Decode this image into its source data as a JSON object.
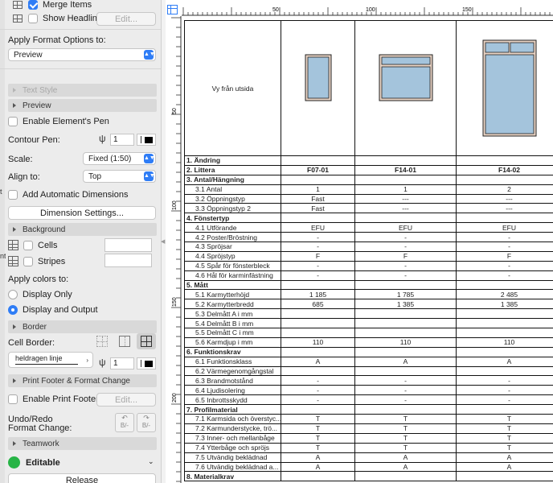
{
  "panel": {
    "merge_items": "Merge Items",
    "show_headline": "Show Headline",
    "edit_label": "Edit...",
    "apply_format_options_to": "Apply Format Options to:",
    "apply_target": "Preview",
    "sections": {
      "text_style": "Text Style",
      "preview": "Preview",
      "background": "Background",
      "border": "Border",
      "print_footer": "Print Footer & Format Change",
      "teamwork": "Teamwork"
    },
    "enable_elements_pen": "Enable Element's Pen",
    "contour_pen_label": "Contour Pen:",
    "contour_pen_value": "1",
    "scale_label": "Scale:",
    "scale_value": "Fixed (1:50)",
    "align_label": "Align to:",
    "align_value": "Top",
    "add_automatic_dimensions": "Add Automatic Dimensions",
    "dimension_settings": "Dimension Settings...",
    "cells_label": "Cells",
    "stripes_label": "Stripes",
    "apply_colors_to": "Apply colors to:",
    "display_only": "Display Only",
    "display_and_output": "Display and Output",
    "cell_border_label": "Cell Border:",
    "line_type": "heldragen linje",
    "border_pen_value": "1",
    "enable_print_footer": "Enable Print Footer",
    "edit_label_2": "Edit...",
    "undo_redo_label": "Undo/Redo",
    "format_change_label": "Format Change:",
    "undo_icon_text": "B/-",
    "redo_icon_text": "B/-",
    "editable_label": "Editable",
    "release_label": "Release",
    "edge_tab_1": "t",
    "edge_tab_2": "nt",
    "colors": {
      "accent": "#2f7df6",
      "editable_dot": "#27b446"
    }
  },
  "ruler": {
    "h_marks": [
      "50",
      "100",
      "150"
    ],
    "v_marks": [
      "50",
      "100",
      "150",
      "200"
    ]
  },
  "table": {
    "header_caption": "Vy från utsida",
    "columns": [
      "F07-01",
      "F14-01",
      "F14-02"
    ],
    "rows": [
      {
        "label": "1. Ändring",
        "section": true,
        "values": [
          "",
          "",
          ""
        ]
      },
      {
        "label": "2. Littera",
        "section": true,
        "values": [
          "F07-01",
          "F14-01",
          "F14-02"
        ]
      },
      {
        "label": "3. Antal/Hängning",
        "section": true,
        "values": [
          "",
          "",
          ""
        ]
      },
      {
        "label": "3.1 Antal",
        "section": false,
        "values": [
          "1",
          "1",
          "2"
        ]
      },
      {
        "label": "3.2 Öppningstyp",
        "section": false,
        "values": [
          "Fast",
          "---",
          "---"
        ]
      },
      {
        "label": "3.3 Öppningstyp 2",
        "section": false,
        "values": [
          "Fast",
          "---",
          "---"
        ]
      },
      {
        "label": "4. Fönstertyp",
        "section": true,
        "values": [
          "",
          "",
          ""
        ]
      },
      {
        "label": "4.1 Utförande",
        "section": false,
        "values": [
          "EFU",
          "EFU",
          "EFU"
        ]
      },
      {
        "label": "4.2 Poster/Bröstning",
        "section": false,
        "values": [
          "-",
          "-",
          "-"
        ]
      },
      {
        "label": "4.3 Spröjsar",
        "section": false,
        "values": [
          "-",
          "-",
          "-"
        ]
      },
      {
        "label": "4.4 Spröjstyp",
        "section": false,
        "values": [
          "F",
          "F",
          "F"
        ]
      },
      {
        "label": "4.5 Spår för fönsterbleck",
        "section": false,
        "values": [
          "-",
          "-",
          "-"
        ]
      },
      {
        "label": "4.6 Hål för karminfästning",
        "section": false,
        "values": [
          "-",
          "-",
          "-"
        ]
      },
      {
        "label": "5. Mått",
        "section": true,
        "values": [
          "",
          "",
          ""
        ]
      },
      {
        "label": "5.1 Karmytterhöjd",
        "section": false,
        "values": [
          "1 185",
          "1 785",
          "2 485"
        ]
      },
      {
        "label": "5.2 Karmytterbredd",
        "section": false,
        "values": [
          "685",
          "1 385",
          "1 385"
        ]
      },
      {
        "label": "5.3 Delmått A i mm",
        "section": false,
        "values": [
          "",
          "",
          ""
        ]
      },
      {
        "label": "5.4 Delmått B i mm",
        "section": false,
        "values": [
          "",
          "",
          ""
        ]
      },
      {
        "label": "5.5 Delmått C i mm",
        "section": false,
        "values": [
          "",
          "",
          ""
        ]
      },
      {
        "label": "5.6 Karmdjup i mm",
        "section": false,
        "values": [
          "110",
          "110",
          "110"
        ]
      },
      {
        "label": "6. Funktionskrav",
        "section": true,
        "values": [
          "",
          "",
          ""
        ]
      },
      {
        "label": "6.1 Funktionsklass",
        "section": false,
        "values": [
          "A",
          "A",
          "A"
        ]
      },
      {
        "label": "6.2 Värmegenomgångstal",
        "section": false,
        "values": [
          "",
          "",
          ""
        ]
      },
      {
        "label": "6.3 Brandmotstånd",
        "section": false,
        "values": [
          "-",
          "-",
          "-"
        ]
      },
      {
        "label": "6.4 Ljudisolering",
        "section": false,
        "values": [
          "-",
          "-",
          "-"
        ]
      },
      {
        "label": "6.5 Inbrottsskydd",
        "section": false,
        "values": [
          "-",
          "-",
          "-"
        ]
      },
      {
        "label": "7. Profilmaterial",
        "section": true,
        "values": [
          "",
          "",
          ""
        ]
      },
      {
        "label": "7.1 Karmsida och överstyc...",
        "section": false,
        "values": [
          "T",
          "T",
          "T"
        ]
      },
      {
        "label": "7.2 Karmunderstycke, trö...",
        "section": false,
        "values": [
          "T",
          "T",
          "T"
        ]
      },
      {
        "label": "7.3 Inner- och mellanbåge",
        "section": false,
        "values": [
          "T",
          "T",
          "T"
        ]
      },
      {
        "label": "7.4 Ytterbåge och spröjs",
        "section": false,
        "values": [
          "T",
          "T",
          "T"
        ]
      },
      {
        "label": "7.5 Utvändig beklädnad",
        "section": false,
        "values": [
          "A",
          "A",
          "A"
        ]
      },
      {
        "label": "7.6 Utvändig beklädnad a...",
        "section": false,
        "values": [
          "A",
          "A",
          "A"
        ]
      },
      {
        "label": "8. Materialkrav",
        "section": true,
        "values": [
          "",
          "",
          ""
        ]
      }
    ]
  }
}
